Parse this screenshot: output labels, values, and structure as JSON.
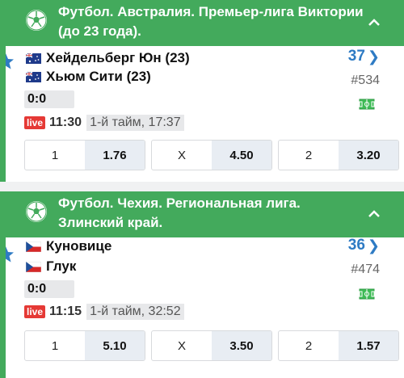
{
  "colors": {
    "accent": "#43aa5c",
    "link": "#2e7bc4",
    "live": "#e53935"
  },
  "events": [
    {
      "header": "Футбол. Австралия. Премьер-лига Виктории (до 23 года).",
      "team1": "Хейдельберг Юн (23)",
      "team2": "Хьюм Сити (23)",
      "team1_flag": "flag-australia-icon",
      "team2_flag": "flag-australia-icon",
      "score": "0:0",
      "live_label": "live",
      "time": "11:30",
      "period": "1-й тайм, 17:37",
      "markets_count": "37",
      "match_id": "#534",
      "odds": [
        {
          "label": "1",
          "value": "1.76"
        },
        {
          "label": "X",
          "value": "4.50"
        },
        {
          "label": "2",
          "value": "3.20"
        }
      ]
    },
    {
      "header": "Футбол. Чехия. Региональная лига. Злинский край.",
      "team1": "Куновице",
      "team2": "Глук",
      "team1_flag": "flag-czech-icon",
      "team2_flag": "flag-czech-icon",
      "score": "0:0",
      "live_label": "live",
      "time": "11:15",
      "period": "1-й тайм, 32:52",
      "markets_count": "36",
      "match_id": "#474",
      "odds": [
        {
          "label": "1",
          "value": "5.10"
        },
        {
          "label": "X",
          "value": "3.50"
        },
        {
          "label": "2",
          "value": "1.57"
        }
      ]
    }
  ]
}
